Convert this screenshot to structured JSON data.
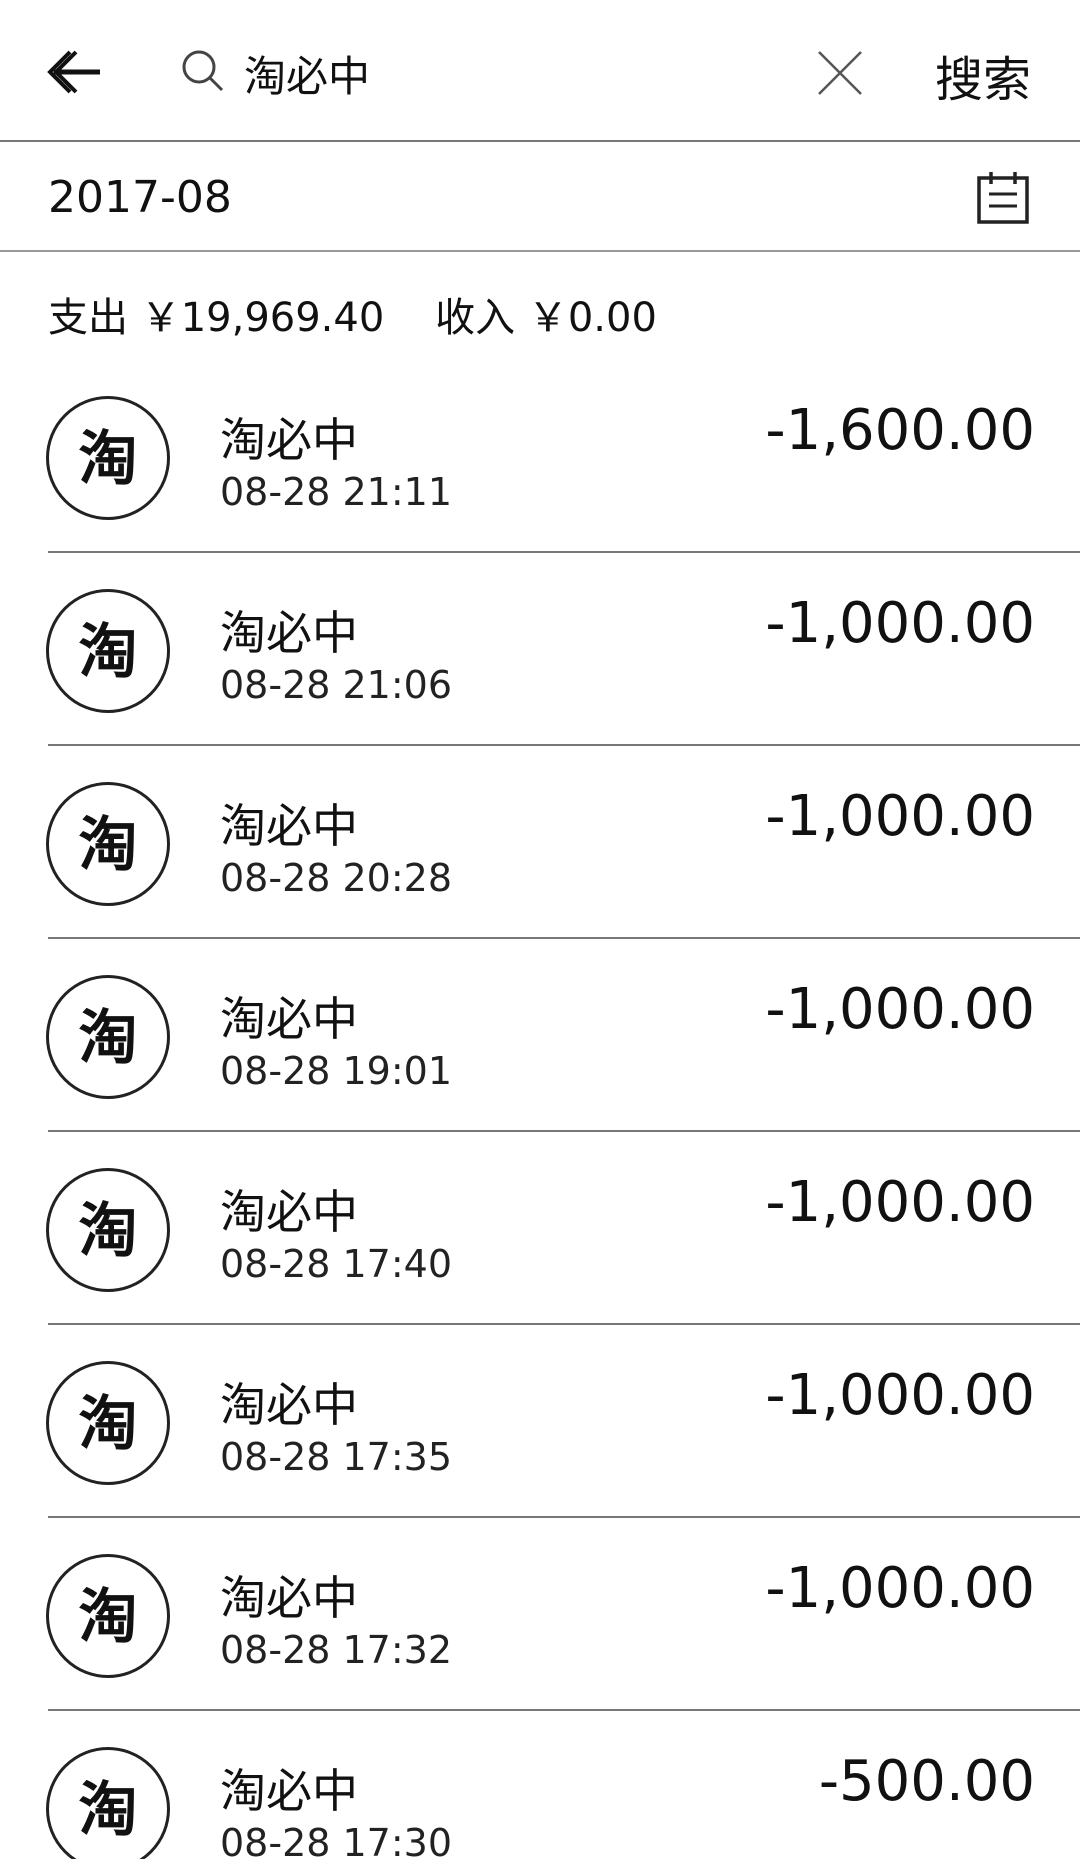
{
  "header": {
    "search_value": "淘必中",
    "search_button": "搜索"
  },
  "filter": {
    "month": "2017-08"
  },
  "summary": {
    "text": "支出 ￥19,969.40    收入 ￥0.00"
  },
  "transactions": [
    {
      "name": "淘必中",
      "time": "08-28  21:11",
      "amount": "-1,600.00",
      "icon": "taobao-icon"
    },
    {
      "name": "淘必中",
      "time": "08-28  21:06",
      "amount": "-1,000.00",
      "icon": "taobao-icon"
    },
    {
      "name": "淘必中",
      "time": "08-28  20:28",
      "amount": "-1,000.00",
      "icon": "taobao-icon"
    },
    {
      "name": "淘必中",
      "time": "08-28  19:01",
      "amount": "-1,000.00",
      "icon": "taobao-icon"
    },
    {
      "name": "淘必中",
      "time": "08-28  17:40",
      "amount": "-1,000.00",
      "icon": "taobao-icon"
    },
    {
      "name": "淘必中",
      "time": "08-28  17:35",
      "amount": "-1,000.00",
      "icon": "taobao-icon"
    },
    {
      "name": "淘必中",
      "time": "08-28  17:32",
      "amount": "-1,000.00",
      "icon": "taobao-icon"
    },
    {
      "name": "淘必中",
      "time": "08-28  17:30",
      "amount": "-500.00",
      "icon": "taobao-icon"
    }
  ]
}
